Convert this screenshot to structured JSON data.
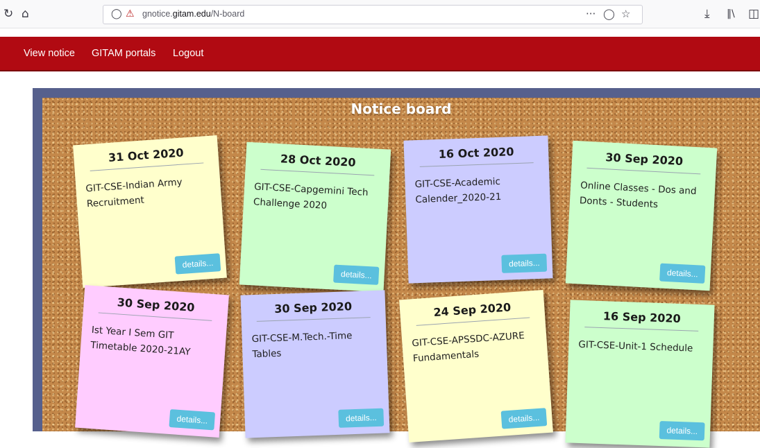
{
  "browser": {
    "url_prefix": "gnotice.",
    "url_domain": "gitam.edu",
    "url_path": "/N-board",
    "more_glyph": "···"
  },
  "nav": {
    "items": [
      {
        "label": "View notice"
      },
      {
        "label": "GITAM portals"
      },
      {
        "label": "Logout"
      }
    ]
  },
  "board": {
    "title": "Notice board",
    "details_label": "details...",
    "notes": [
      {
        "date": "31 Oct 2020",
        "title": "GIT-CSE-Indian Army Recruitment",
        "color": "#ffffcc"
      },
      {
        "date": "28 Oct 2020",
        "title": "GIT-CSE-Capgemini Tech Challenge 2020",
        "color": "#ccffcc"
      },
      {
        "date": "16 Oct 2020",
        "title": "GIT-CSE-Academic Calender_2020-21",
        "color": "#ccccff"
      },
      {
        "date": "30 Sep 2020",
        "title": "Online Classes - Dos and Donts - Students",
        "color": "#ccffcc"
      },
      {
        "date": "30 Sep 2020",
        "title": "Ist Year I Sem GIT Timetable 2020-21AY",
        "color": "#ffccff"
      },
      {
        "date": "30 Sep 2020",
        "title": "GIT-CSE-M.Tech.-Time Tables",
        "color": "#ccccff"
      },
      {
        "date": "24 Sep 2020",
        "title": "GIT-CSE-APSSDC-AZURE Fundamentals",
        "color": "#ffffcc"
      },
      {
        "date": "16 Sep 2020",
        "title": "GIT-CSE-Unit-1 Schedule",
        "color": "#ccffcc"
      }
    ]
  },
  "colors": {
    "nav_bg": "#b10a12",
    "board_frame": "#56608d",
    "cork": "#c4884a",
    "details_button": "#5bc0de"
  }
}
